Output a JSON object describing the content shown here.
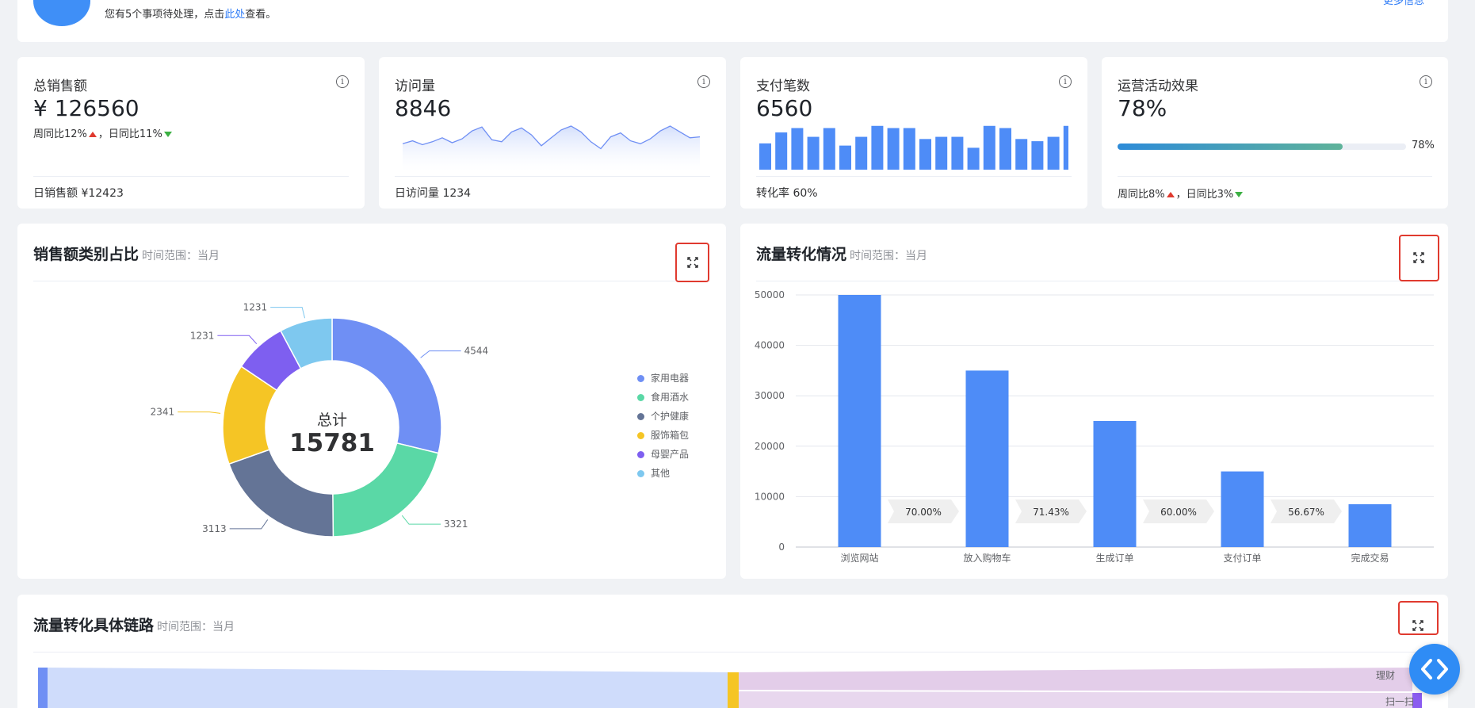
{
  "notice": {
    "text_before": "您有5个事项待处理，点击",
    "link": "此处",
    "text_after": "查看。",
    "more_link": "更多信息"
  },
  "stats": [
    {
      "title": "总销售额",
      "value": "¥ 126560",
      "footer": "日销售额 ¥12423",
      "compare_week": "周同比12%",
      "compare_day": "，日同比11%"
    },
    {
      "title": "访问量",
      "value": "8846",
      "footer": "日访问量 1234"
    },
    {
      "title": "支付笔数",
      "value": "6560",
      "footer": "转化率 60%"
    },
    {
      "title": "运营活动效果",
      "value": "78%",
      "progress_label": "78%",
      "progress": 0.78,
      "compare_week": "周同比8%",
      "compare_day": "，日同比3%"
    }
  ],
  "panels": {
    "sales_category": {
      "title": "销售额类别占比",
      "sub": "时间范围：当月"
    },
    "traffic_conversion": {
      "title": "流量转化情况",
      "sub": "时间范围：当月"
    },
    "traffic_chain": {
      "title": "流量转化具体链路",
      "sub": "时间范围：当月"
    }
  },
  "sankey_labels": [
    "理财",
    "扫一扫"
  ],
  "colors": {
    "primary": "#4e8cf7",
    "accent_red": "#e03a2f",
    "down_green": "#3cb043"
  },
  "chart_data": [
    {
      "type": "line",
      "values": [
        28,
        31,
        27,
        30,
        34,
        29,
        33,
        41,
        45,
        32,
        30,
        40,
        44,
        37,
        26,
        34,
        42,
        46,
        40,
        30,
        23,
        35,
        39,
        31,
        28,
        33,
        41,
        46,
        40,
        34,
        35
      ]
    },
    {
      "type": "bar",
      "values": [
        12,
        17,
        19,
        15,
        19,
        11,
        15,
        20,
        19,
        19,
        14,
        15,
        15,
        10,
        20,
        19,
        14,
        13,
        15,
        20
      ]
    },
    {
      "type": "pie",
      "center_label": "总计",
      "center_value": "15781",
      "slices": [
        {
          "name": "家用电器",
          "value": 4544,
          "color": "#6f8ff4"
        },
        {
          "name": "食用酒水",
          "value": 3321,
          "color": "#5ad8a6"
        },
        {
          "name": "个护健康",
          "value": 3113,
          "color": "#647496"
        },
        {
          "name": "服饰箱包",
          "value": 2341,
          "color": "#f5c525"
        },
        {
          "name": "母婴产品",
          "value": 1231,
          "color": "#7e5ff0"
        },
        {
          "name": "其他",
          "value": 1231,
          "color": "#7ec8ef"
        }
      ]
    },
    {
      "type": "bar",
      "categories": [
        "浏览网站",
        "放入购物车",
        "生成订单",
        "支付订单",
        "完成交易"
      ],
      "values": [
        50000,
        35000,
        25000,
        15000,
        8500
      ],
      "ylim": [
        0,
        50000
      ],
      "yticks": [
        0,
        10000,
        20000,
        30000,
        40000,
        50000
      ],
      "rates": [
        "70.00%",
        "71.43%",
        "60.00%",
        "56.67%"
      ]
    }
  ]
}
